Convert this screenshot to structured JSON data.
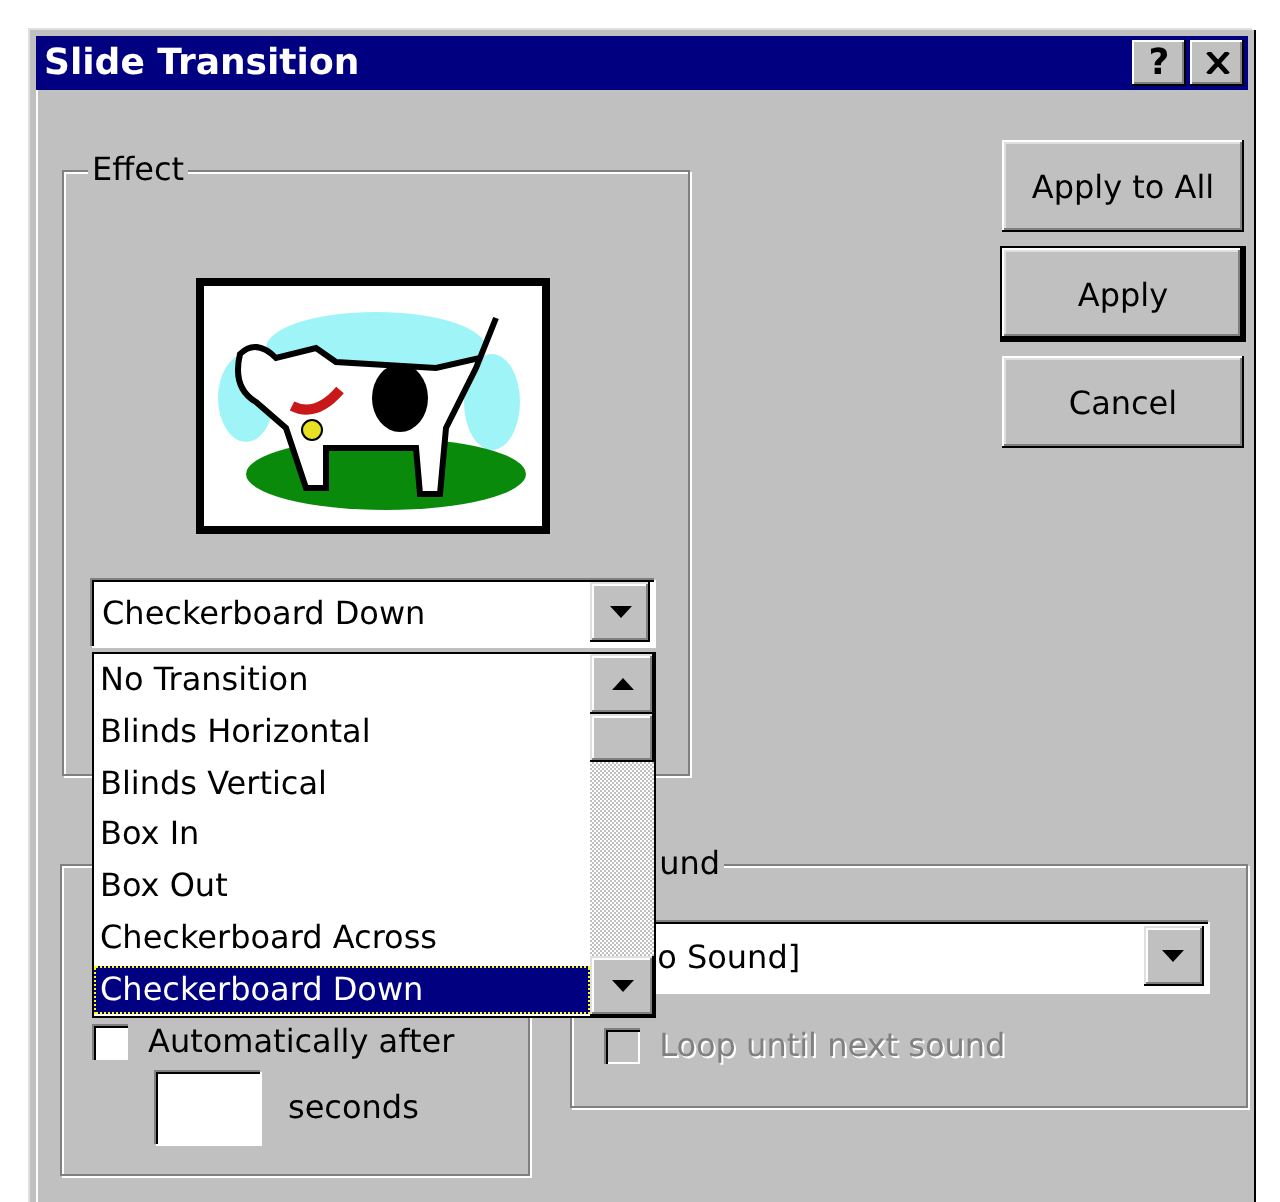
{
  "window": {
    "title": "Slide Transition",
    "help_button": "?"
  },
  "effect": {
    "label": "Effect",
    "combo": {
      "value": "Checkerboard Down"
    },
    "options": [
      {
        "label": "No Transition",
        "selected": false
      },
      {
        "label": "Blinds Horizontal",
        "selected": false
      },
      {
        "label": "Blinds Vertical",
        "selected": false
      },
      {
        "label": "Box In",
        "selected": false
      },
      {
        "label": "Box Out",
        "selected": false
      },
      {
        "label": "Checkerboard Across",
        "selected": false
      },
      {
        "label": "Checkerboard Down",
        "selected": true
      }
    ]
  },
  "buttons": [
    {
      "label": "Apply to All",
      "default": false
    },
    {
      "label": "Apply",
      "default": true
    },
    {
      "label": "Cancel",
      "default": false
    }
  ],
  "advance": {
    "automatic": {
      "label": "Automatically after",
      "checked": false
    },
    "seconds_label": "seconds"
  },
  "sound": {
    "label": "und",
    "value": "o Sound]",
    "loop": {
      "label": "Loop until next sound",
      "checked": false,
      "disabled": true
    }
  }
}
